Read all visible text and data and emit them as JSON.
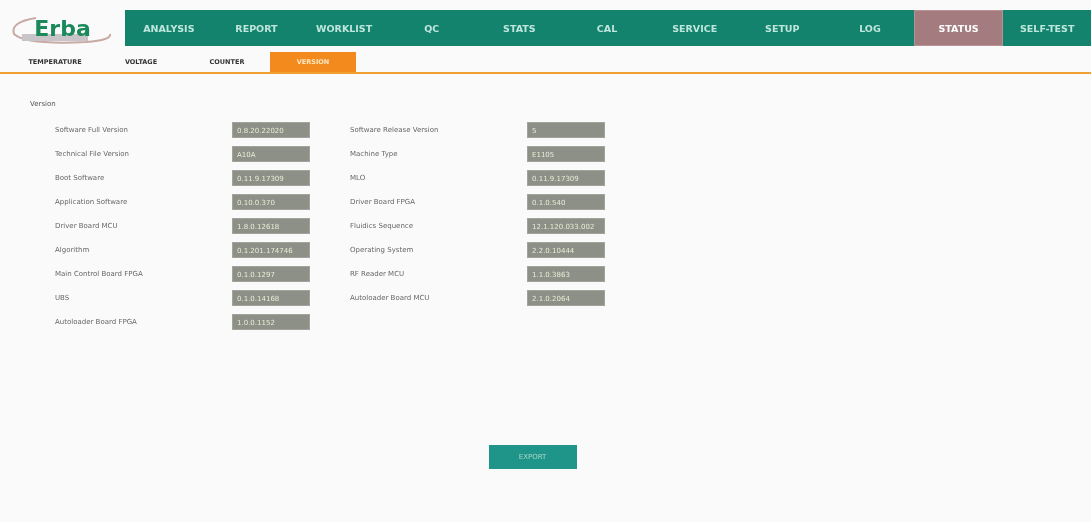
{
  "logo": {
    "text": "Erba"
  },
  "nav_tabs": [
    {
      "label": "ANALYSIS",
      "selected": false
    },
    {
      "label": "REPORT",
      "selected": false
    },
    {
      "label": "WORKLIST",
      "selected": false
    },
    {
      "label": "QC",
      "selected": false
    },
    {
      "label": "STATS",
      "selected": false
    },
    {
      "label": "CAL",
      "selected": false
    },
    {
      "label": "SERVICE",
      "selected": false
    },
    {
      "label": "SETUP",
      "selected": false
    },
    {
      "label": "LOG",
      "selected": false
    },
    {
      "label": "STATUS",
      "selected": true
    },
    {
      "label": "SELF-TEST",
      "selected": false
    }
  ],
  "sub_tabs": [
    {
      "label": "TEMPERATURE",
      "selected": false
    },
    {
      "label": "VOLTAGE",
      "selected": false
    },
    {
      "label": "COUNTER",
      "selected": false
    },
    {
      "label": "VERSION",
      "selected": true
    }
  ],
  "section_title": "Version",
  "columns": [
    [
      {
        "label": "Software Full Version",
        "value": "0.8.20.22020"
      },
      {
        "label": "Technical File Version",
        "value": "A10A"
      },
      {
        "label": "Boot Software",
        "value": "0.11.9.17309"
      },
      {
        "label": "Application Software",
        "value": "0.10.0.370"
      },
      {
        "label": "Driver Board MCU",
        "value": "1.8.0.12618"
      },
      {
        "label": "Algorithm",
        "value": "0.1.201.174746"
      },
      {
        "label": "Main Control Board FPGA",
        "value": "0.1.0.1297"
      },
      {
        "label": "UBS",
        "value": "0.1.0.14168"
      },
      {
        "label": "Autoloader Board FPGA",
        "value": "1.0.0.1152"
      }
    ],
    [
      {
        "label": "Software Release Version",
        "value": "5"
      },
      {
        "label": "Machine Type",
        "value": "E1105"
      },
      {
        "label": "MLO",
        "value": "0.11.9.17309"
      },
      {
        "label": "Driver Board FPGA",
        "value": "0.1.0.540"
      },
      {
        "label": "Fluidics Sequence",
        "value": "12.1.120.033.002"
      },
      {
        "label": "Operating System",
        "value": "2.2.0.10444"
      },
      {
        "label": "RF Reader MCU",
        "value": "1.1.0.3863"
      },
      {
        "label": "Autoloader Board MCU",
        "value": "2.1.0.2064"
      }
    ]
  ],
  "export_button": "EXPORT"
}
